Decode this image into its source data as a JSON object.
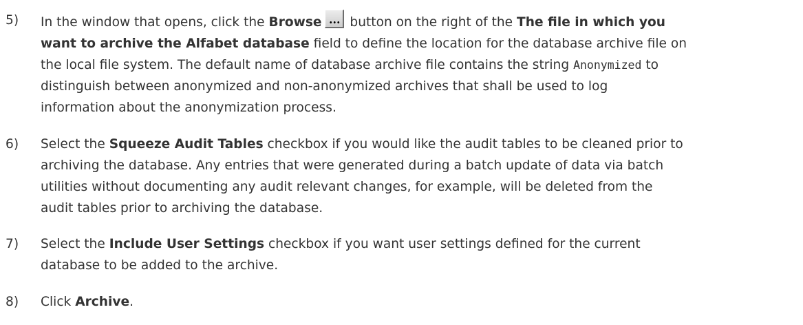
{
  "steps": [
    {
      "number": "5)",
      "segments": {
        "l1a": "In the window that opens, click the ",
        "l1b": "Browse",
        "l1c": " button on the right of the ",
        "l1d": "The file in which you",
        "l2a": "want to archive the Alfabet database",
        "l2b": " field to define the location for the database archive file on",
        "l3": "the local file system. The default name of database archive file contains the string ",
        "l3code": "Anonymized",
        "l3b": " to",
        "l4": "distinguish between anonymized and non-anonymized archives that shall be used to log",
        "l5": "information about the anonymization process."
      }
    },
    {
      "number": "6)",
      "segments": {
        "l1a": "Select the ",
        "l1b": "Squeeze Audit Tables",
        "l1c": " checkbox if you would like the audit tables to be cleaned prior to",
        "l2": "archiving the database. Any entries that were generated during a batch update of data via batch",
        "l3": "utilities without documenting any audit relevant changes, for example, will be deleted from the",
        "l4": "audit tables prior to archiving the database."
      }
    },
    {
      "number": "7)",
      "segments": {
        "l1a": "Select the ",
        "l1b": "Include User Settings",
        "l1c": " checkbox if you want user settings defined for the current",
        "l2": "database to be added to the archive."
      }
    },
    {
      "number": "8)",
      "segments": {
        "l1a": "Click ",
        "l1b": "Archive",
        "l1c": "."
      }
    }
  ],
  "icons": {
    "browse": "browse-ellipsis-icon"
  }
}
